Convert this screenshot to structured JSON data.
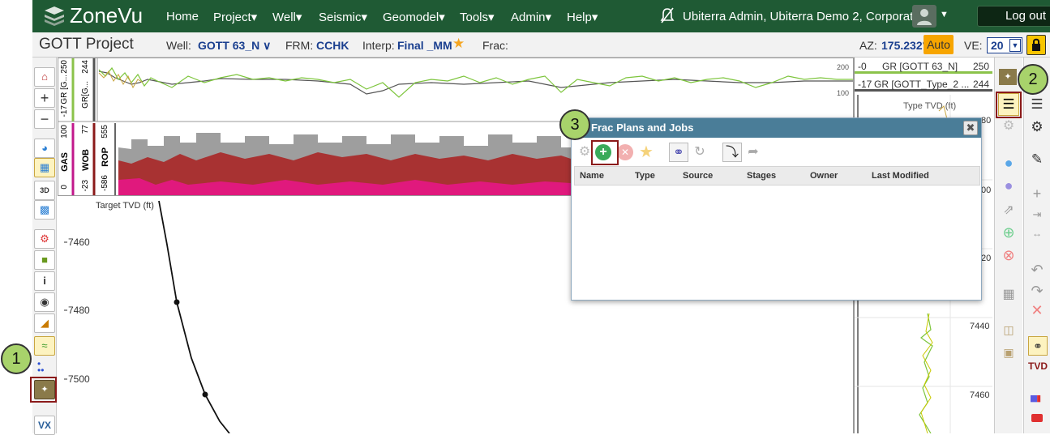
{
  "app": {
    "logo_text": "ZoneVu",
    "nav": [
      "Home",
      "Project▾",
      "Well▾",
      "Seismic▾",
      "Geomodel▾",
      "Tools▾",
      "Admin▾",
      "Help▾"
    ],
    "user": "Ubiterra Admin, Ubiterra Demo 2, Corporate",
    "logout": "Log out"
  },
  "header": {
    "project": "GOTT Project",
    "well_label": "Well:",
    "well_value": "GOTT 63_N ∨",
    "frm_label": "FRM:",
    "frm_value": "CCHK",
    "interp_label": "Interp:",
    "interp_value": "Final _MM",
    "frac_label": "Frac:",
    "az_label": "AZ:",
    "az_value": "175.232°",
    "auto": "Auto",
    "ve_label": "VE:",
    "ve_value": "20"
  },
  "tracks": {
    "gr_left_min": "-17",
    "gr_left_label": "GR [G...",
    "gr_left_max": "250",
    "gr2_label": "GR[G...",
    "gr2_max": "244",
    "gr_right_top": "200",
    "gr_right_bottom": "100",
    "gas_label": "GAS",
    "gas_min": "0",
    "gas_max": "100",
    "wob_label": "WOB",
    "wob_min": "-23",
    "wob_max": "77",
    "rop_label": "ROP",
    "rop_min": "-586",
    "rop_max": "555"
  },
  "plot": {
    "axis_label": "Target TVD (ft)",
    "ticks": [
      "7460",
      "7480",
      "7500"
    ]
  },
  "right_panel": {
    "gr1_min": "-0",
    "gr1_label": "GR [GOTT 63_N]",
    "gr1_max": "250",
    "gr2_min": "-17",
    "gr2_label": "GR [GOTT_Type_2 ...",
    "gr2_max": "244",
    "axis_label": "Type TVD (ft)",
    "ticks": [
      "80",
      "00",
      "20",
      "7440",
      "7460"
    ]
  },
  "dialog": {
    "title": "Frac Plans and Jobs",
    "columns": [
      "Name",
      "Type",
      "Source",
      "Stages",
      "Owner",
      "Last Modified"
    ]
  },
  "toolbar_right": {
    "tvd": "TVD"
  },
  "left_toolbar": {
    "info": "i",
    "threed": "3D",
    "vx": "VX"
  },
  "callouts": [
    "1",
    "2",
    "3"
  ],
  "colors": {
    "nav_bg": "#1f5a34",
    "dialog_title_bg": "#4a7d98",
    "gas_fill": "#e0197d",
    "rop_fill": "#a83232",
    "wob_fill": "#9e9e9e",
    "callout_bg": "#a8d36b",
    "highlight": "#8b1a1a"
  }
}
